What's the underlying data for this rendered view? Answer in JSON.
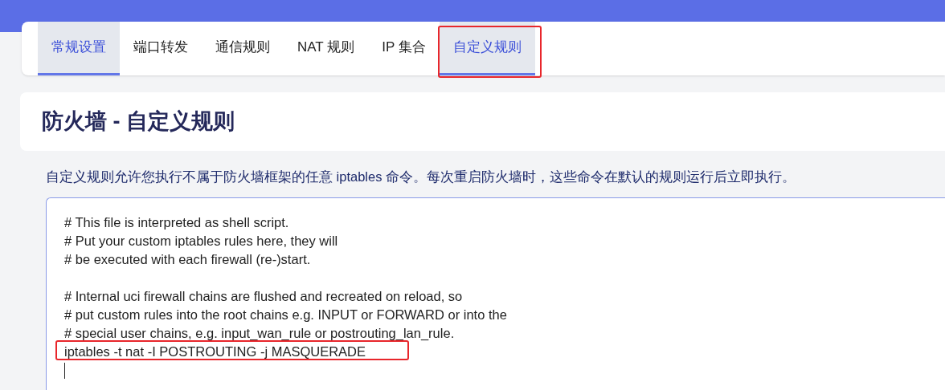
{
  "tabs": [
    {
      "label": "常规设置",
      "selected": true,
      "annotated": false
    },
    {
      "label": "端口转发",
      "selected": false,
      "annotated": false
    },
    {
      "label": "通信规则",
      "selected": false,
      "annotated": false
    },
    {
      "label": "NAT 规则",
      "selected": false,
      "annotated": false
    },
    {
      "label": "IP 集合",
      "selected": false,
      "annotated": false
    },
    {
      "label": "自定义规则",
      "selected": true,
      "annotated": true
    }
  ],
  "title": "防火墙 - 自定义规则",
  "description": "自定义规则允许您执行不属于防火墙框架的任意 iptables 命令。每次重启防火墙时，这些命令在默认的规则运行后立即执行。",
  "editor": {
    "blocks": [
      {
        "lines": [
          {
            "text": "# This file is interpreted as shell script.",
            "annotated": false
          },
          {
            "text": "# Put your custom iptables rules here, they will",
            "annotated": false
          },
          {
            "text": "# be executed with each firewall (re-)start.",
            "annotated": false
          }
        ]
      },
      {
        "lines": [
          {
            "text": "# Internal uci firewall chains are flushed and recreated on reload, so",
            "annotated": false
          },
          {
            "text": "# put custom rules into the root chains e.g. INPUT or FORWARD or into the",
            "annotated": false
          },
          {
            "text": "# special user chains, e.g. input_wan_rule or postrouting_lan_rule.",
            "annotated": false
          },
          {
            "text": "iptables -t nat -I POSTROUTING -j MASQUERADE",
            "annotated": true
          }
        ]
      }
    ]
  }
}
